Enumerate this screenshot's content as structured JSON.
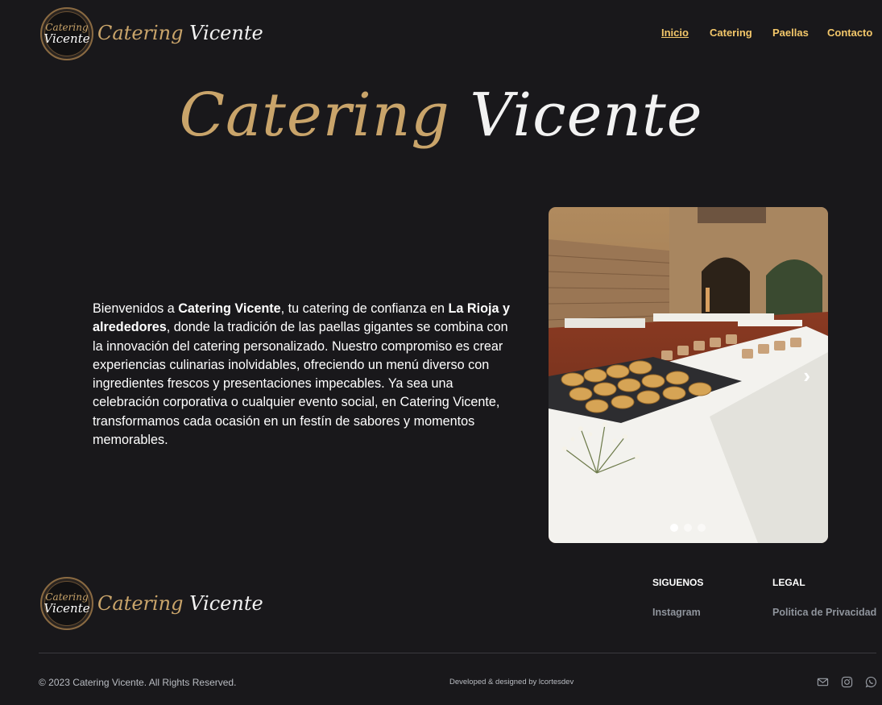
{
  "header": {
    "logo": {
      "line1": "Catering",
      "line2": "Vicente"
    },
    "wordmark": {
      "first": "Catering",
      "second": "Vicente"
    },
    "nav": [
      {
        "label": "Inicio",
        "active": true
      },
      {
        "label": "Catering",
        "active": false
      },
      {
        "label": "Paellas",
        "active": false
      },
      {
        "label": "Contacto",
        "active": false
      }
    ]
  },
  "hero": {
    "title_first": "Catering",
    "title_second": "Vicente"
  },
  "intro": {
    "p1": "Bienvenidos a ",
    "brand": "Catering Vicente",
    "p2": ", tu catering de confianza en ",
    "region": "La Rioja y alrededores",
    "p3": ", donde la tradición de las paellas gigantes se combina con la innovación del catering personalizado. Nuestro compromiso es crear experiencias culinarias inolvidables, ofreciendo un menú diverso con ingredientes frescos y presentaciones impecables. Ya sea una celebración corporativa o cualquier evento social, en Catering Vicente, transformamos cada ocasión en un festín de sabores y momentos memorables."
  },
  "carousel": {
    "next_icon": "chevron-right-icon",
    "slide_count": 3,
    "active_slide": 1
  },
  "footer": {
    "siguenos": {
      "heading": "SIGUENOS",
      "link": "Instagram"
    },
    "legal": {
      "heading": "LEGAL",
      "link": "Politica de Privacidad"
    },
    "copyright": "© 2023 Catering Vicente. All Rights Reserved.",
    "developer": "Developed & designed by lcortesdev",
    "social_icons": [
      "mail-icon",
      "instagram-icon",
      "whatsapp-icon"
    ]
  },
  "colors": {
    "background": "#19181b",
    "nav_accent": "#f3c76a",
    "gold": "#c9a46a"
  }
}
